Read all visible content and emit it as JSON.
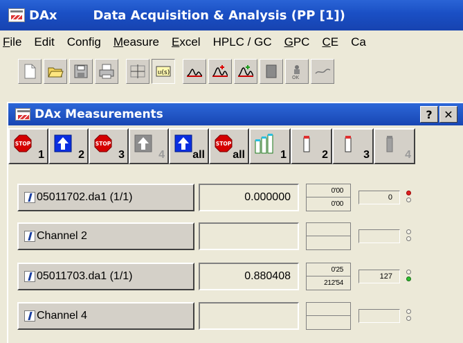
{
  "window": {
    "app_short": "DAx",
    "title": "Data Acquisition & Analysis (PP [1])"
  },
  "menu": [
    {
      "label": "File",
      "accel": "F",
      "rest": "ile"
    },
    {
      "label": "Edit",
      "accel": "",
      "rest": "Edit"
    },
    {
      "label": "Config",
      "accel": "",
      "rest": "Config"
    },
    {
      "label": "Measure",
      "accel": "M",
      "rest": "easure"
    },
    {
      "label": "Excel",
      "accel": "E",
      "rest": "xcel"
    },
    {
      "label": "HPLC / GC",
      "accel": "",
      "rest": "HPLC / GC"
    },
    {
      "label": "GPC",
      "accel": "G",
      "rest": "PC"
    },
    {
      "label": "CE",
      "accel": "C",
      "rest": "E"
    },
    {
      "label": "Ca",
      "accel": "",
      "rest": "Ca"
    }
  ],
  "toolbar": {
    "icons": [
      "new-file-icon",
      "open-folder-icon",
      "save-icon",
      "print-icon",
      "crosshair-icon",
      "measure-scale-icon",
      "chromatogram-black-icon",
      "chromatogram-red-icon",
      "chromatogram-green-icon",
      "report-icon",
      "ok-user-icon",
      "curve-icon"
    ]
  },
  "measurements": {
    "title": "DAx Measurements",
    "help_label": "?",
    "close_label": "✕",
    "controls": [
      {
        "icon": "stop-icon",
        "num": "1",
        "disabled": false
      },
      {
        "icon": "start-arrow-icon",
        "num": "2",
        "disabled": false
      },
      {
        "icon": "stop-icon",
        "num": "3",
        "disabled": false
      },
      {
        "icon": "start-arrow-icon",
        "num": "4",
        "disabled": true
      },
      {
        "icon": "start-arrow-icon",
        "num": "all",
        "disabled": false
      },
      {
        "icon": "stop-icon",
        "num": "all",
        "disabled": false
      },
      {
        "icon": "vials-icon",
        "num": "1",
        "disabled": false
      },
      {
        "icon": "vial-icon",
        "num": "2",
        "disabled": false
      },
      {
        "icon": "vial-icon",
        "num": "3",
        "disabled": false
      },
      {
        "icon": "vial-icon",
        "num": "4",
        "disabled": true
      }
    ],
    "channels": [
      {
        "name": "05011702.da1 (1/1)",
        "value": "0.000000",
        "time_top": "0'00",
        "time_bottom": "0'00",
        "count": "0",
        "led_top": "red",
        "led_bottom": "off"
      },
      {
        "name": "Channel 2",
        "value": "",
        "time_top": "",
        "time_bottom": "",
        "count": "",
        "led_top": "off",
        "led_bottom": "off"
      },
      {
        "name": "05011703.da1 (1/1)",
        "value": "0.880408",
        "time_top": "0'25",
        "time_bottom": "212'54",
        "count": "127",
        "led_top": "off",
        "led_bottom": "green"
      },
      {
        "name": "Channel 4",
        "value": "",
        "time_top": "",
        "time_bottom": "",
        "count": "",
        "led_top": "off",
        "led_bottom": "off"
      }
    ]
  }
}
